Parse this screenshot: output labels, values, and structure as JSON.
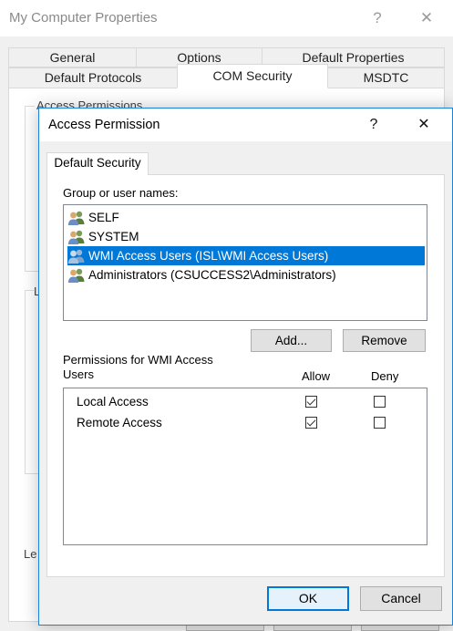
{
  "back_window": {
    "title": "My Computer Properties",
    "help_glyph": "?",
    "close_glyph": "✕",
    "tabs_row1": [
      "General",
      "Options",
      "Default Properties"
    ],
    "tabs_row2": [
      "Default Protocols",
      "COM Security",
      "MSDTC"
    ],
    "active_tab": "COM Security",
    "group1_label": "Access Permissions",
    "group2_label": "L",
    "learn_text": "Le"
  },
  "dialog": {
    "title": "Access Permission",
    "help_glyph": "?",
    "close_glyph": "✕",
    "tab_label": "Default Security",
    "group_label": "Group or user names:",
    "users": [
      {
        "name": "SELF",
        "selected": false
      },
      {
        "name": "SYSTEM",
        "selected": false
      },
      {
        "name": "WMI Access Users (ISL\\WMI Access Users)",
        "selected": true
      },
      {
        "name": "Administrators (CSUCCESS2\\Administrators)",
        "selected": false
      }
    ],
    "add_button": "Add...",
    "remove_button": "Remove",
    "permissions_label": "Permissions for WMI Access Users",
    "allow_header": "Allow",
    "deny_header": "Deny",
    "permissions": [
      {
        "name": "Local Access",
        "allow": true,
        "deny": false
      },
      {
        "name": "Remote Access",
        "allow": true,
        "deny": false
      }
    ],
    "ok_button": "OK",
    "cancel_button": "Cancel"
  },
  "colors": {
    "selection": "#0078d7",
    "dialog_border": "#1883d7"
  },
  "icons": {
    "user": "user-group-icon"
  }
}
